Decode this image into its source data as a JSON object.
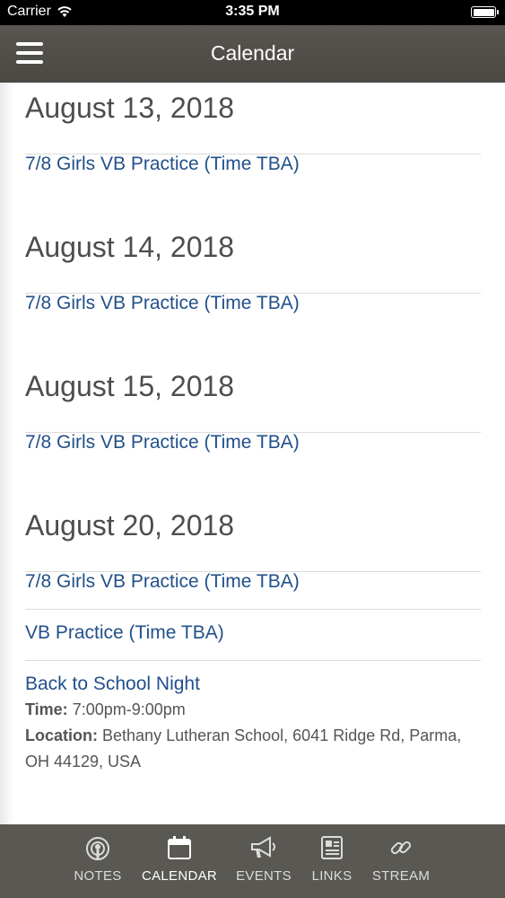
{
  "status": {
    "carrier": "Carrier",
    "time": "3:35 PM"
  },
  "nav": {
    "title": "Calendar"
  },
  "days": [
    {
      "date": "August 13, 2018",
      "events": [
        {
          "title": "7/8 Girls VB Practice (Time TBA)"
        }
      ]
    },
    {
      "date": "August 14, 2018",
      "events": [
        {
          "title": "7/8 Girls VB Practice (Time TBA)"
        }
      ]
    },
    {
      "date": "August 15, 2018",
      "events": [
        {
          "title": "7/8 Girls VB Practice (Time TBA)"
        }
      ]
    },
    {
      "date": "August 20, 2018",
      "events": [
        {
          "title": "7/8 Girls VB Practice (Time TBA)"
        },
        {
          "title": "VB Practice (Time TBA)"
        },
        {
          "title": "Back to School Night",
          "time_label": "Time:",
          "time_value": "7:00pm-9:00pm",
          "location_label": "Location:",
          "location_value": "Bethany Lutheran School, 6041 Ridge Rd, Parma, OH 44129, USA"
        }
      ]
    }
  ],
  "tabs": [
    {
      "label": "NOTES",
      "icon": "podcast-icon"
    },
    {
      "label": "CALENDAR",
      "icon": "calendar-icon",
      "active": true
    },
    {
      "label": "EVENTS",
      "icon": "megaphone-icon"
    },
    {
      "label": "LINKS",
      "icon": "news-icon"
    },
    {
      "label": "STREAM",
      "icon": "link-icon"
    }
  ],
  "colors": {
    "nav_bg": "#4f4d48",
    "tab_bg": "#5a5853",
    "link": "#22508a",
    "heading": "#4d4d4d"
  }
}
